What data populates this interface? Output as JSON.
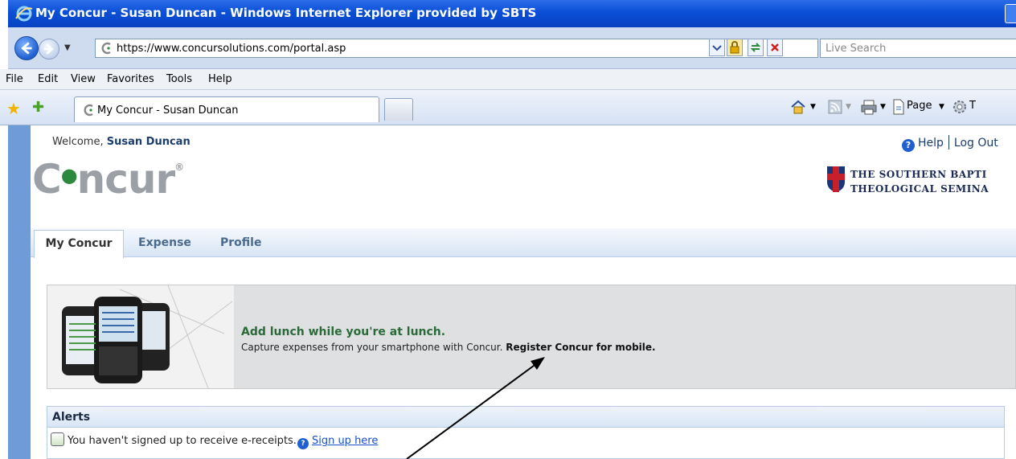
{
  "window": {
    "title": "My Concur - Susan Duncan - Windows Internet Explorer provided by SBTS"
  },
  "address_bar": {
    "url": "https://www.concursolutions.com/portal.asp",
    "search_placeholder": "Live Search"
  },
  "menu": {
    "items": [
      "File",
      "Edit",
      "View",
      "Favorites",
      "Tools",
      "Help"
    ]
  },
  "browser_tabs": {
    "active_label": "My Concur - Susan Duncan",
    "page_label": "Page",
    "tools_label": "T"
  },
  "header": {
    "welcome_prefix": "Welcome,",
    "user_name": "Susan Duncan",
    "help_label": "Help",
    "logout_label": "Log Out",
    "logo_text": "ncur",
    "logo_c": "C",
    "logo_reg": "®",
    "org_line1": "THE SOUTHERN BAPTI",
    "org_line2": "THEOLOGICAL SEMINA"
  },
  "nav": {
    "tabs": [
      "My Concur",
      "Expense",
      "Profile"
    ]
  },
  "banner": {
    "title": "Add lunch while you're at lunch.",
    "text": "Capture expenses from your smartphone with Concur.",
    "link": "Register Concur for mobile."
  },
  "alerts": {
    "heading": "Alerts",
    "message": "You haven't signed up to receive e-receipts.",
    "link": "Sign up here"
  },
  "colors": {
    "titlebar": "#0a4fd6",
    "rail": "#6f9bd8",
    "banner_title": "#2a6b3a",
    "link": "#1a4fc8"
  }
}
